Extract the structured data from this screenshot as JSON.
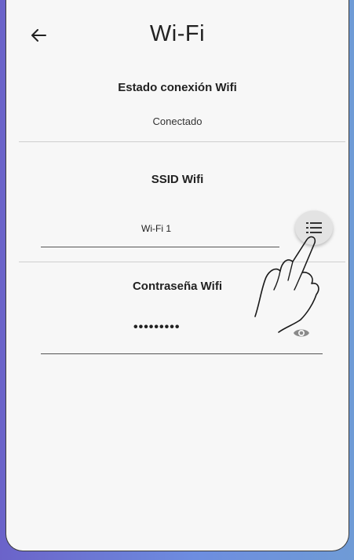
{
  "header": {
    "title": "Wi-Fi",
    "back_icon": "arrow-left-icon"
  },
  "connection": {
    "label": "Estado conexión Wifi",
    "status": "Conectado"
  },
  "ssid": {
    "label": "SSID Wifi",
    "value": "Wi-Fi 1",
    "list_icon": "list-icon"
  },
  "password": {
    "label": "Contraseña Wifi",
    "masked_value": "•••••••••",
    "visibility_icon": "eye-icon"
  },
  "overlay": {
    "hand_icon": "pointing-hand-icon"
  },
  "colors": {
    "screen_bg": "#f7f7f7",
    "accent_edge": "#6b63c9"
  }
}
